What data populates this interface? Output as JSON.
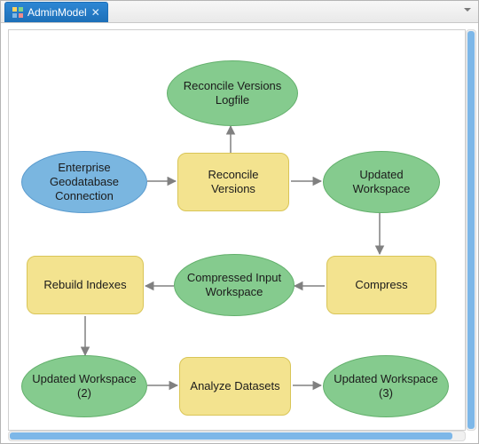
{
  "tab": {
    "title": "AdminModel"
  },
  "nodes": {
    "input1": "Enterprise Geodatabase Connection",
    "tool1": "Reconcile Versions",
    "out1a": "Reconcile Versions Logfile",
    "out1b": "Updated Workspace",
    "tool2": "Compress",
    "out2": "Compressed Input Workspace",
    "tool3": "Rebuild Indexes",
    "out3": "Updated Workspace (2)",
    "tool4": "Analyze Datasets",
    "out4": "Updated Workspace (3)"
  },
  "colors": {
    "inputFill": "#7ab6e0",
    "toolFill": "#f3e38f",
    "dataFill": "#85cb8e",
    "arrow": "#808080"
  }
}
